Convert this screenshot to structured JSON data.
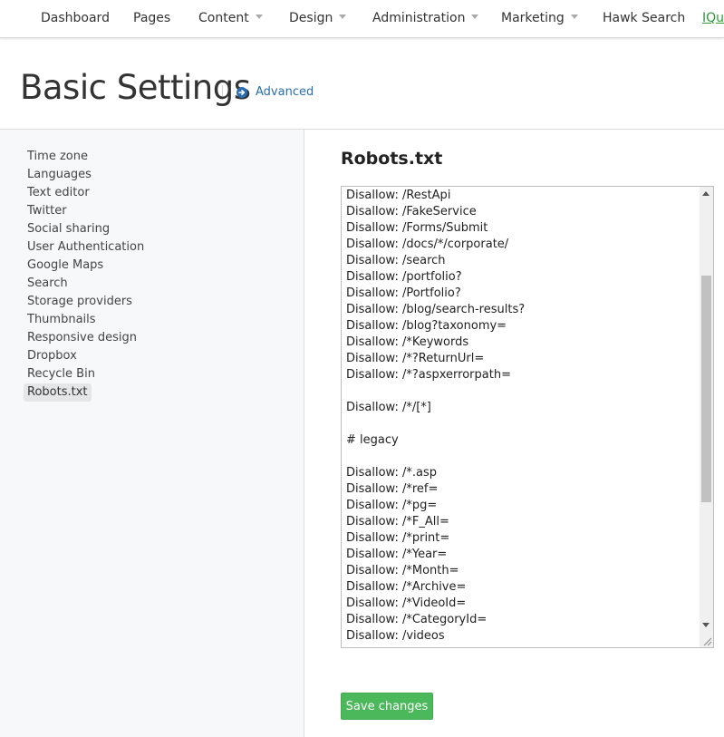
{
  "nav": {
    "items": [
      {
        "label": "Dashboard",
        "dropdown": false
      },
      {
        "label": "Pages",
        "dropdown": false
      },
      {
        "label": "Content",
        "dropdown": true
      },
      {
        "label": "Design",
        "dropdown": true
      },
      {
        "label": "Administration",
        "dropdown": true
      },
      {
        "label": "Marketing",
        "dropdown": true
      },
      {
        "label": "Hawk Search",
        "dropdown": false
      },
      {
        "label": "IQue",
        "dropdown": false
      }
    ]
  },
  "header": {
    "title": "Basic Settings",
    "advanced_label": "Advanced",
    "advanced_icon": "arrow-circle-right-icon"
  },
  "sidebar": {
    "items": [
      {
        "label": "Time zone",
        "active": false
      },
      {
        "label": "Languages",
        "active": false
      },
      {
        "label": "Text editor",
        "active": false
      },
      {
        "label": "Twitter",
        "active": false
      },
      {
        "label": "Social sharing",
        "active": false
      },
      {
        "label": "User Authentication",
        "active": false
      },
      {
        "label": "Google Maps",
        "active": false
      },
      {
        "label": "Search",
        "active": false
      },
      {
        "label": "Storage providers",
        "active": false
      },
      {
        "label": "Thumbnails",
        "active": false
      },
      {
        "label": "Responsive design",
        "active": false
      },
      {
        "label": "Dropbox",
        "active": false
      },
      {
        "label": "Recycle Bin",
        "active": false
      },
      {
        "label": "Robots.txt",
        "active": true
      }
    ]
  },
  "main": {
    "section_title": "Robots.txt",
    "robots_lines": [
      "Disallow: /RestApi",
      "Disallow: /FakeService",
      "Disallow: /Forms/Submit",
      "Disallow: /docs/*/corporate/",
      "Disallow: /search",
      "Disallow: /portfolio?",
      "Disallow: /Portfolio?",
      "Disallow: /blog/search-results?",
      "Disallow: /blog?taxonomy=",
      "Disallow: /*Keywords",
      "Disallow: /*?ReturnUrl=",
      "Disallow: /*?aspxerrorpath=",
      "",
      "Disallow: /*/[*]",
      "",
      "# legacy",
      "",
      "Disallow: /*.asp",
      "Disallow: /*ref=",
      "Disallow: /*pg=",
      "Disallow: /*F_All=",
      "Disallow: /*print=",
      "Disallow: /*Year=",
      "Disallow: /*Month=",
      "Disallow: /*Archive=",
      "Disallow: /*VideoId=",
      "Disallow: /*CategoryId=",
      "Disallow: /videos"
    ],
    "save_label": "Save changes"
  },
  "colors": {
    "accent_link": "#2a6eb4",
    "save_button": "#4cb85c",
    "active_item_bg": "#e4e6e8"
  }
}
